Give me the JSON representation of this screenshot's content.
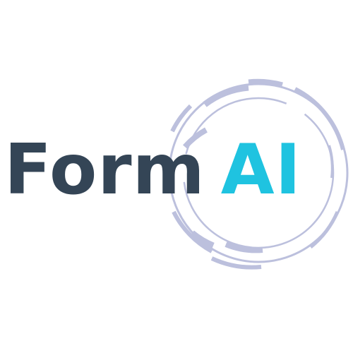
{
  "logo": {
    "word_primary": "Form",
    "word_accent": "AI",
    "colors": {
      "primary_text": "#344556",
      "accent_text": "#1fc3e0",
      "ring": "#bcc0dd"
    },
    "icon": "circular-ring-icon"
  }
}
